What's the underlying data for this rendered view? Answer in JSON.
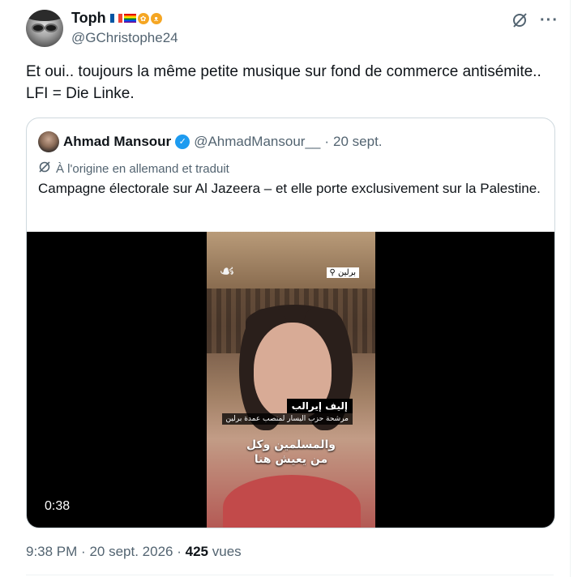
{
  "tweet": {
    "display_name": "Toph",
    "handle": "@GChristophe24",
    "text": "Et oui.. toujours la même petite musique sur fond de commerce antisémite.. LFI = Die Linke.",
    "icons": [
      "grok-icon",
      "more-icon"
    ]
  },
  "quote": {
    "display_name": "Ahmad Mansour",
    "handle": "@AhmadMansour__",
    "separator": "·",
    "date": "20 sept.",
    "translated_note": "À l'origine en allemand et traduit",
    "text": "Campagne électorale sur Al Jazeera – et elle porte exclusivement sur la Palestine.",
    "video": {
      "duration": "0:38",
      "location_tag": "برلين",
      "name_plate": "إليف إيرالب",
      "role_caption": "مرشحة حزب اليسار لمنصب عمدة برلين",
      "subtitle_line1": "والمسلمين وكل",
      "subtitle_line2": "من يعيش هنا"
    }
  },
  "footer": {
    "time": "9:38 PM",
    "sep1": "·",
    "date": "20 sept. 2026",
    "sep2": "·",
    "views_count": "425",
    "views_label": "vues"
  },
  "colors": {
    "text": "#0f1419",
    "secondary": "#536471",
    "verified": "#1d9bf0",
    "border": "#cfd9de"
  }
}
